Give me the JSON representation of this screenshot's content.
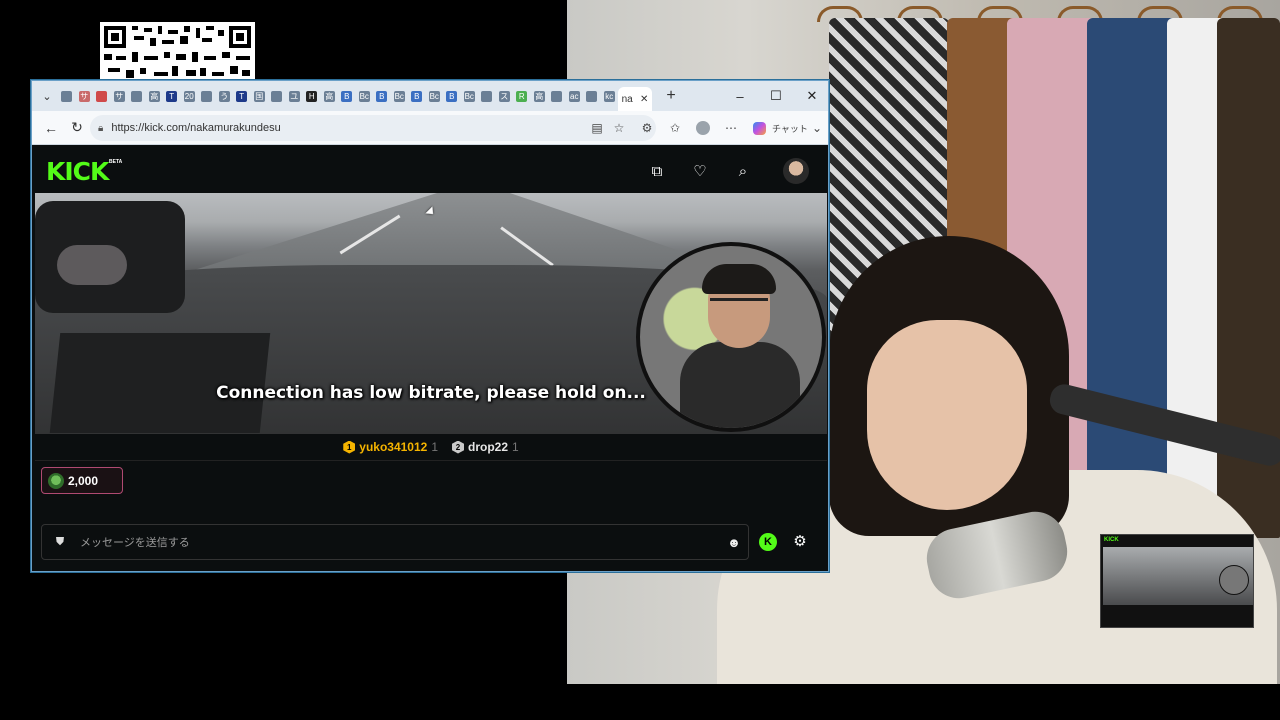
{
  "overlay": {
    "qr_label": "QR code"
  },
  "browser": {
    "tabs_mini": [
      {
        "letter": "",
        "color": "#6b7f95"
      },
      {
        "letter": "サ",
        "color": "#c96a6a"
      },
      {
        "letter": "",
        "color": "#d04a4a"
      },
      {
        "letter": "サ",
        "color": "#6b7f95"
      },
      {
        "letter": "",
        "color": "#6b7f95"
      },
      {
        "letter": "高",
        "color": "#6b7f95"
      },
      {
        "letter": "T",
        "color": "#1e3a8a"
      },
      {
        "letter": "20",
        "color": "#6b7f95"
      },
      {
        "letter": "",
        "color": "#6b7f95"
      },
      {
        "letter": "う",
        "color": "#6b7f95"
      },
      {
        "letter": "T",
        "color": "#1e3a8a"
      },
      {
        "letter": "国",
        "color": "#6b7f95"
      },
      {
        "letter": "",
        "color": "#6b7f95"
      },
      {
        "letter": "ユ",
        "color": "#6b7f95"
      },
      {
        "letter": "H",
        "color": "#222"
      },
      {
        "letter": "高",
        "color": "#6b7f95"
      },
      {
        "letter": "B",
        "color": "#3b6fc2"
      },
      {
        "letter": "Bc",
        "color": "#6b7f95"
      },
      {
        "letter": "B",
        "color": "#3b6fc2"
      },
      {
        "letter": "Bc",
        "color": "#6b7f95"
      },
      {
        "letter": "B",
        "color": "#3b6fc2"
      },
      {
        "letter": "Bc",
        "color": "#6b7f95"
      },
      {
        "letter": "B",
        "color": "#3b6fc2"
      },
      {
        "letter": "Bc",
        "color": "#6b7f95"
      },
      {
        "letter": "",
        "color": "#6b7f95"
      },
      {
        "letter": "ス",
        "color": "#6b7f95"
      },
      {
        "letter": "R",
        "color": "#4caf50"
      },
      {
        "letter": "高",
        "color": "#6b7f95"
      },
      {
        "letter": "",
        "color": "#6b7f95"
      },
      {
        "letter": "ac",
        "color": "#6b7f95"
      },
      {
        "letter": "",
        "color": "#6b7f95"
      },
      {
        "letter": "kc",
        "color": "#6b7f95"
      }
    ],
    "active_tab_label": "na",
    "active_tab_close": "✕",
    "new_tab": "+",
    "url": "https://kick.com/nakamurakundesu",
    "copilot_label": "チャット",
    "window_controls": {
      "minimize": "–",
      "maximize": "☐",
      "close": "✕"
    }
  },
  "kick": {
    "logo": "KICK",
    "beta": "BETA",
    "video": {
      "status_message": "Connection has low bitrate, please hold on..."
    },
    "leaderboard": [
      {
        "rank": "1",
        "name": "yuko341012",
        "count": "1",
        "badge_color": "#f5b400",
        "name_color": "#f5b400"
      },
      {
        "rank": "2",
        "name": "drop22",
        "count": "1",
        "badge_color": "#c9c9c9",
        "name_color": "#e6e6e6"
      }
    ],
    "pinned_chip_value": "2,000",
    "chat": {
      "placeholder": "メッセージを送信する"
    },
    "colors": {
      "brand": "#53fc18",
      "background": "#0b0e0f"
    }
  },
  "pip": {
    "logo": "KICK"
  }
}
